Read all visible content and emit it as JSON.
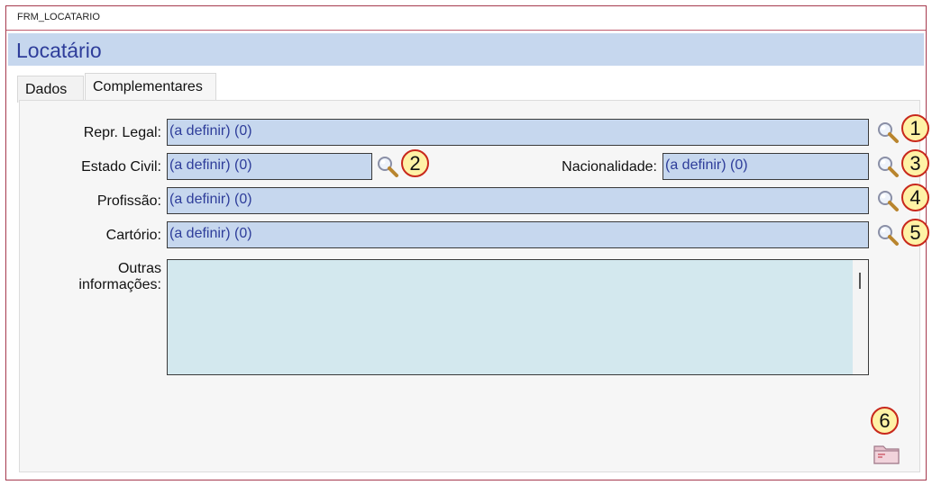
{
  "window": {
    "title": "FRM_LOCATARIO"
  },
  "header": {
    "title": "Locatário"
  },
  "tabs": [
    {
      "label": "Dados"
    },
    {
      "label": "Complementares"
    }
  ],
  "form": {
    "repr_legal": {
      "label": "Repr. Legal:",
      "value": "(a definir) (0)"
    },
    "estado_civil": {
      "label": "Estado Civil:",
      "value": "(a definir) (0)"
    },
    "nacionalidade": {
      "label": "Nacionalidade:",
      "value": "(a definir) (0)"
    },
    "profissao": {
      "label": "Profissão:",
      "value": "(a definir) (0)"
    },
    "cartorio": {
      "label": "Cartório:",
      "value": "(a definir) (0)"
    },
    "outras": {
      "label_line1": "Outras",
      "label_line2": "informações:",
      "value": ""
    }
  },
  "badges": [
    "1",
    "2",
    "3",
    "4",
    "5",
    "6"
  ],
  "icons": {
    "lookup": "magnifier-icon",
    "folder": "folder-icon"
  },
  "colors": {
    "header_bg": "#c6d7ee",
    "field_bg": "#c6d7ee",
    "memo_bg": "#d3e8ee",
    "badge_border": "#c8281c",
    "badge_fill": "#fff2a6"
  }
}
